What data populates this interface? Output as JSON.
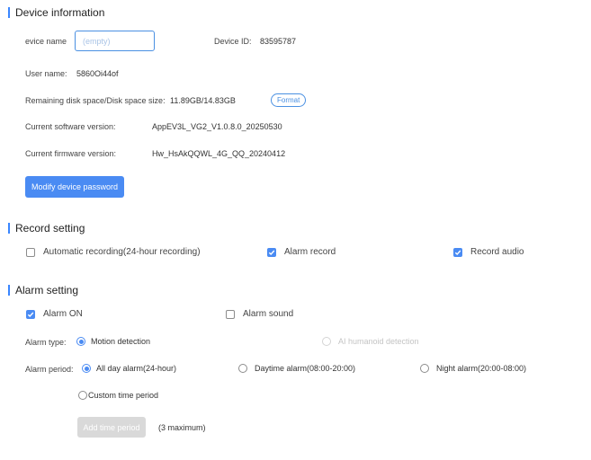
{
  "device_info": {
    "title": "Device information",
    "name_label": "evice name",
    "name_placeholder": "(empty)",
    "id_label": "Device ID:",
    "id_value": "83595787",
    "user_label": "User name:",
    "user_value": "5860Oi44of",
    "disk_label": "Remaining disk space/Disk space size:",
    "disk_value": "11.89GB/14.83GB",
    "format_label": "Format",
    "software_label": "Current software version:",
    "software_value": "AppEV3L_VG2_V1.0.8.0_20250530",
    "firmware_label": "Current firmware version:",
    "firmware_value": "Hw_HsAkQQWL_4G_QQ_20240412",
    "modify_password_label": "Modify device password"
  },
  "record_setting": {
    "title": "Record setting",
    "auto_recording": {
      "label": "Automatic recording(24-hour recording)",
      "checked": false
    },
    "alarm_record": {
      "label": "Alarm record",
      "checked": true
    },
    "record_audio": {
      "label": "Record audio",
      "checked": true
    }
  },
  "alarm_setting": {
    "title": "Alarm setting",
    "alarm_on": {
      "label": "Alarm ON",
      "checked": true
    },
    "alarm_sound": {
      "label": "Alarm sound",
      "checked": false
    },
    "type_label": "Alarm type:",
    "type_motion": {
      "label": "Motion detection",
      "selected": true
    },
    "type_ai": {
      "label": "AI humanoid detection",
      "selected": false,
      "disabled": true
    },
    "period_label": "Alarm period:",
    "period_all_day": {
      "label": "All day alarm(24-hour)",
      "selected": true
    },
    "period_daytime": {
      "label": "Daytime alarm(08:00-20:00)",
      "selected": false
    },
    "period_night": {
      "label": "Night alarm(20:00-08:00)",
      "selected": false
    },
    "period_custom": {
      "label": "Custom time period",
      "selected": false
    },
    "add_time_label": "Add time period",
    "max_note": "(3 maximum)"
  },
  "colors": {
    "accent": "#4a8bf3",
    "disabled": "#d9d9d9"
  }
}
